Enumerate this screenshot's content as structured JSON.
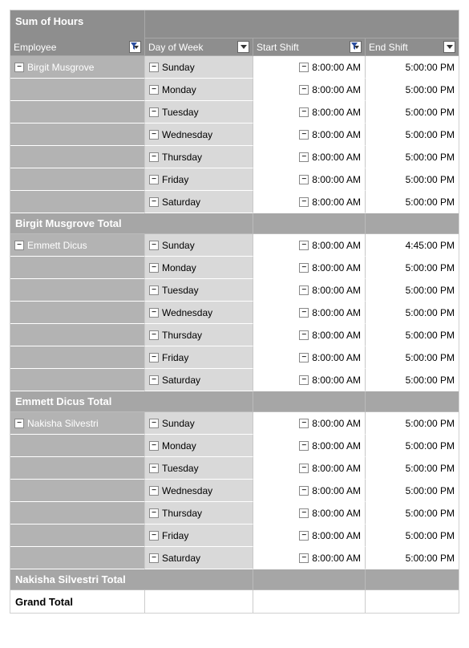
{
  "title": "Sum of Hours",
  "headers": {
    "employee": "Employee",
    "day": "Day of Week",
    "start": "Start Shift",
    "end": "End Shift"
  },
  "grand_total": "Grand Total",
  "groups": [
    {
      "employee": "Birgit Musgrove",
      "total_label": "Birgit Musgrove Total",
      "rows": [
        {
          "day": "Sunday",
          "start": "8:00:00 AM",
          "end": "5:00:00 PM"
        },
        {
          "day": "Monday",
          "start": "8:00:00 AM",
          "end": "5:00:00 PM"
        },
        {
          "day": "Tuesday",
          "start": "8:00:00 AM",
          "end": "5:00:00 PM"
        },
        {
          "day": "Wednesday",
          "start": "8:00:00 AM",
          "end": "5:00:00 PM"
        },
        {
          "day": "Thursday",
          "start": "8:00:00 AM",
          "end": "5:00:00 PM"
        },
        {
          "day": "Friday",
          "start": "8:00:00 AM",
          "end": "5:00:00 PM"
        },
        {
          "day": "Saturday",
          "start": "8:00:00 AM",
          "end": "5:00:00 PM"
        }
      ]
    },
    {
      "employee": "Emmett Dicus",
      "total_label": "Emmett Dicus Total",
      "rows": [
        {
          "day": "Sunday",
          "start": "8:00:00 AM",
          "end": "4:45:00 PM"
        },
        {
          "day": "Monday",
          "start": "8:00:00 AM",
          "end": "5:00:00 PM"
        },
        {
          "day": "Tuesday",
          "start": "8:00:00 AM",
          "end": "5:00:00 PM"
        },
        {
          "day": "Wednesday",
          "start": "8:00:00 AM",
          "end": "5:00:00 PM"
        },
        {
          "day": "Thursday",
          "start": "8:00:00 AM",
          "end": "5:00:00 PM"
        },
        {
          "day": "Friday",
          "start": "8:00:00 AM",
          "end": "5:00:00 PM"
        },
        {
          "day": "Saturday",
          "start": "8:00:00 AM",
          "end": "5:00:00 PM"
        }
      ]
    },
    {
      "employee": "Nakisha Silvestri",
      "total_label": "Nakisha Silvestri Total",
      "rows": [
        {
          "day": "Sunday",
          "start": "8:00:00 AM",
          "end": "5:00:00 PM"
        },
        {
          "day": "Monday",
          "start": "8:00:00 AM",
          "end": "5:00:00 PM"
        },
        {
          "day": "Tuesday",
          "start": "8:00:00 AM",
          "end": "5:00:00 PM"
        },
        {
          "day": "Wednesday",
          "start": "8:00:00 AM",
          "end": "5:00:00 PM"
        },
        {
          "day": "Thursday",
          "start": "8:00:00 AM",
          "end": "5:00:00 PM"
        },
        {
          "day": "Friday",
          "start": "8:00:00 AM",
          "end": "5:00:00 PM"
        },
        {
          "day": "Saturday",
          "start": "8:00:00 AM",
          "end": "5:00:00 PM"
        }
      ]
    }
  ]
}
